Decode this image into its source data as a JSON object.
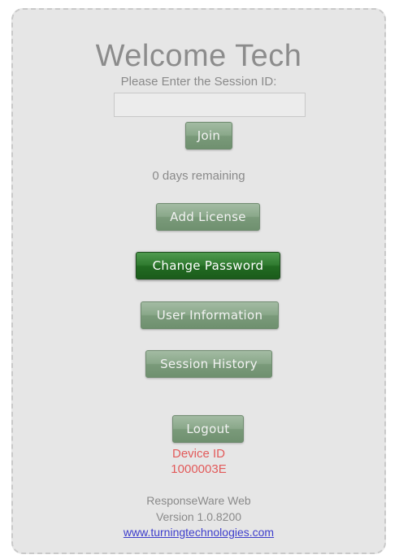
{
  "header": {
    "title": "Welcome Tech",
    "prompt": "Please Enter the Session ID:"
  },
  "session_input": {
    "value": "",
    "placeholder": ""
  },
  "buttons": {
    "join": "Join",
    "add_license": "Add License",
    "change_password": "Change Password",
    "user_information": "User Information",
    "session_history": "Session History",
    "logout": "Logout"
  },
  "status": {
    "days_remaining": "0 days remaining"
  },
  "device": {
    "label": "Device ID",
    "id": "1000003E"
  },
  "footer": {
    "product": "ResponseWare Web",
    "version": "Version 1.0.8200",
    "link": "www.turningtechnologies.com"
  },
  "colors": {
    "button": "#8aa88a",
    "button_active": "#2f7a2f",
    "device_text": "#e25a5a",
    "link": "#3d3dcc",
    "panel_bg": "#e6e6e6"
  }
}
